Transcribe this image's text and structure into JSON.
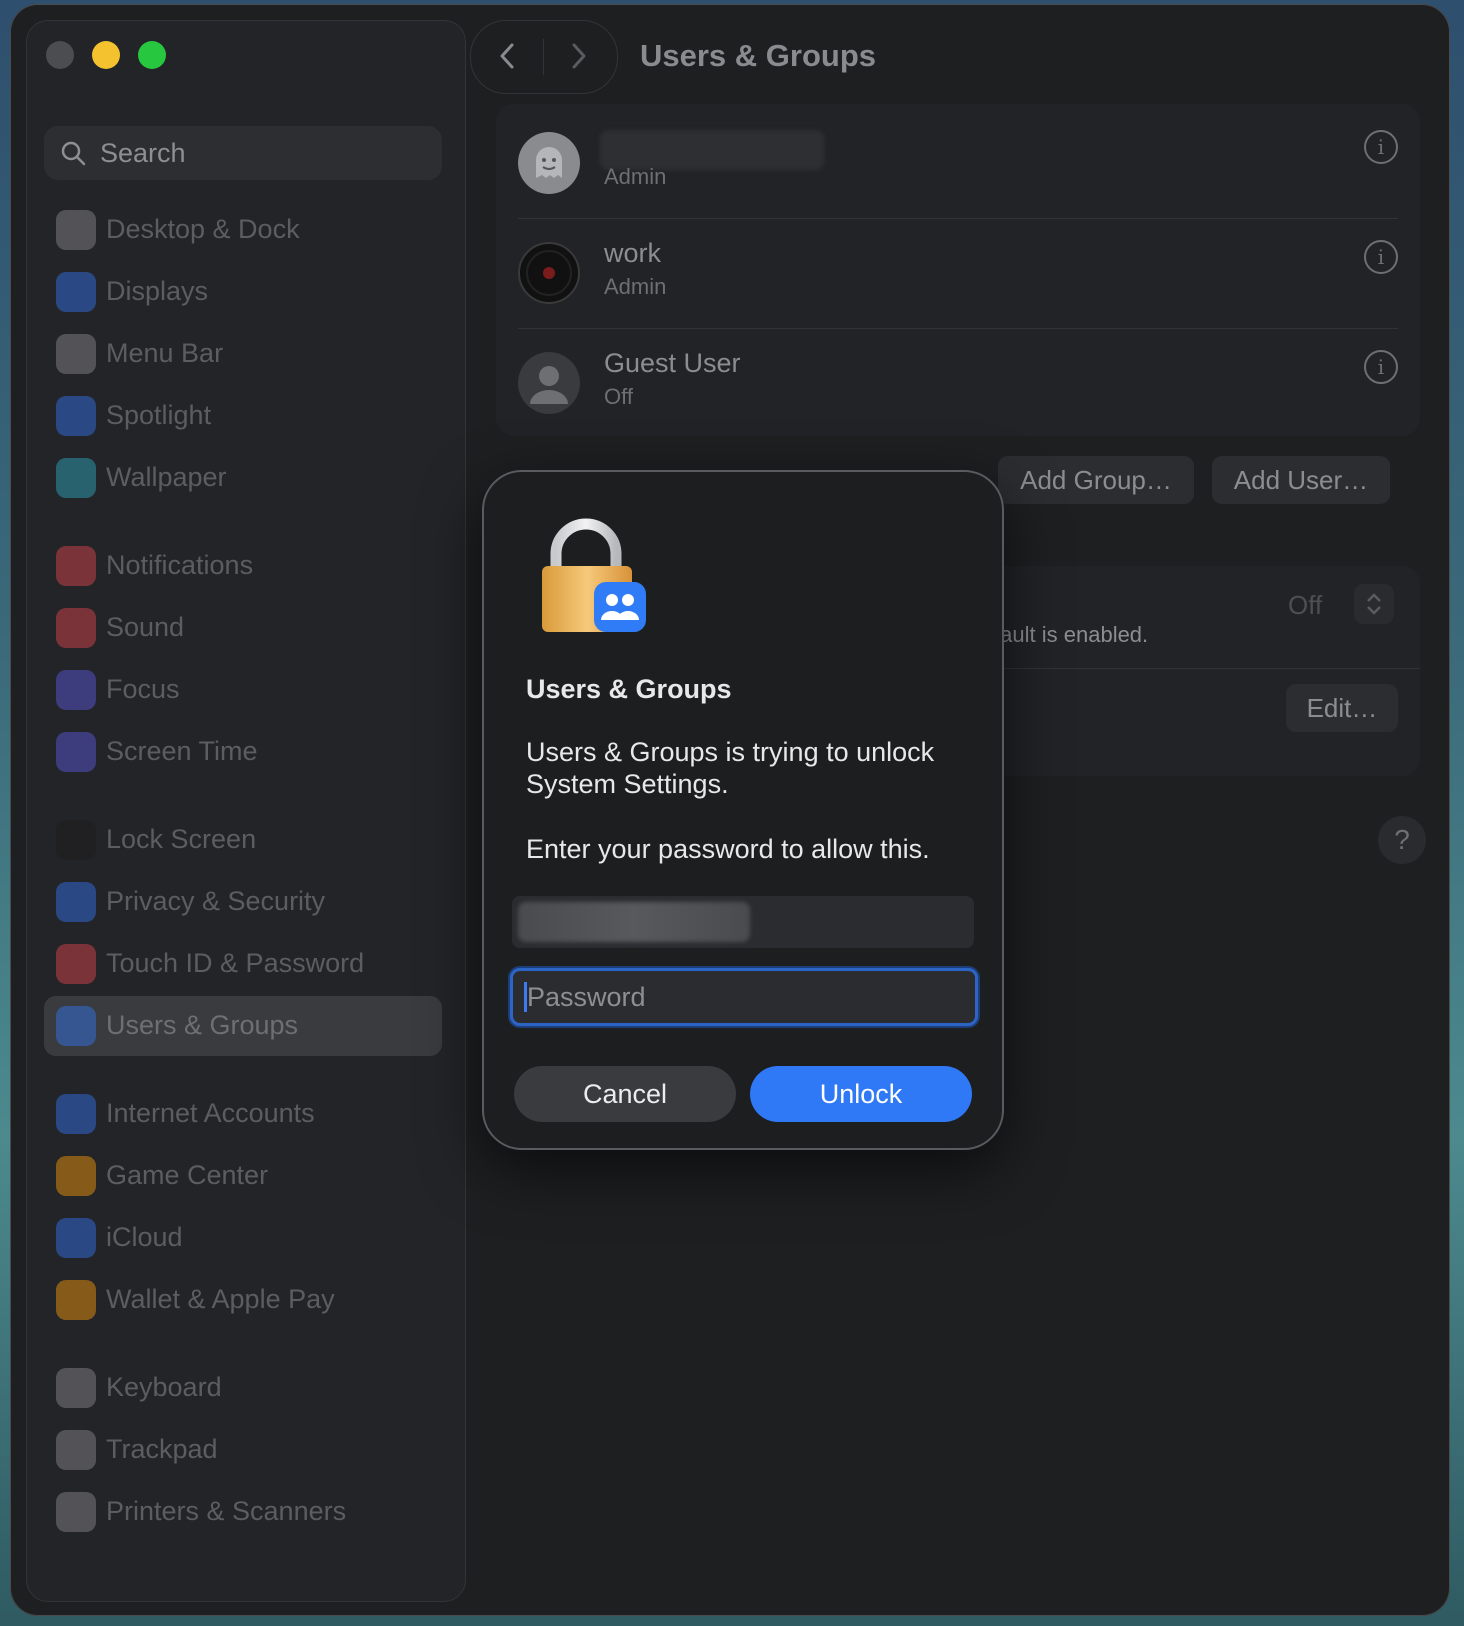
{
  "sidebar": {
    "search_placeholder": "Search",
    "items": [
      {
        "label": "Desktop & Dock",
        "icon": "dock-icon",
        "color": "#8e8e93"
      },
      {
        "label": "Displays",
        "icon": "sun-icon",
        "color": "#3478f6"
      },
      {
        "label": "Menu Bar",
        "icon": "toggles-icon",
        "color": "#8e8e93"
      },
      {
        "label": "Spotlight",
        "icon": "magnifier-icon",
        "color": "#3478f6"
      },
      {
        "label": "Wallpaper",
        "icon": "flower-icon",
        "color": "#30b0c7"
      },
      {
        "label": "Notifications",
        "icon": "bell-icon",
        "color": "#e5484d"
      },
      {
        "label": "Sound",
        "icon": "speaker-icon",
        "color": "#e5484d"
      },
      {
        "label": "Focus",
        "icon": "moon-icon",
        "color": "#5e5ce6"
      },
      {
        "label": "Screen Time",
        "icon": "hourglass-icon",
        "color": "#5e5ce6"
      },
      {
        "label": "Lock Screen",
        "icon": "lock-icon",
        "color": "#1c1c1e"
      },
      {
        "label": "Privacy & Security",
        "icon": "hand-icon",
        "color": "#3478f6"
      },
      {
        "label": "Touch ID & Password",
        "icon": "fingerprint-icon",
        "color": "#e5484d"
      },
      {
        "label": "Users & Groups",
        "icon": "users-icon",
        "color": "#3478f6",
        "selected": true
      },
      {
        "label": "Internet Accounts",
        "icon": "at-icon",
        "color": "#3478f6"
      },
      {
        "label": "Game Center",
        "icon": "game-center-icon",
        "color": "#ff9f0a"
      },
      {
        "label": "iCloud",
        "icon": "cloud-icon",
        "color": "#3478f6"
      },
      {
        "label": "Wallet & Apple Pay",
        "icon": "wallet-icon",
        "color": "#ff9f0a"
      },
      {
        "label": "Keyboard",
        "icon": "keyboard-icon",
        "color": "#8e8e93"
      },
      {
        "label": "Trackpad",
        "icon": "trackpad-icon",
        "color": "#8e8e93"
      },
      {
        "label": "Printers & Scanners",
        "icon": "printer-icon",
        "color": "#8e8e93"
      }
    ]
  },
  "header": {
    "title": "Users & Groups"
  },
  "users": [
    {
      "name": "",
      "role": "Admin"
    },
    {
      "name": "work",
      "role": "Admin"
    },
    {
      "name": "Guest User",
      "role": "Off"
    }
  ],
  "actions": {
    "add_group": "Add Group…",
    "add_user": "Add User…"
  },
  "auto_login": {
    "value": "Off",
    "note": "leVault is enabled.",
    "edit": "Edit…"
  },
  "help_label": "?",
  "dialog": {
    "title": "Users & Groups",
    "message": "Users & Groups is trying to unlock System Settings.",
    "prompt": "Enter your password to allow this.",
    "password_placeholder": "Password",
    "cancel_label": "Cancel",
    "unlock_label": "Unlock"
  },
  "colors": {
    "accent": "#2f78f6",
    "focus_ring": "#2c65c6"
  }
}
